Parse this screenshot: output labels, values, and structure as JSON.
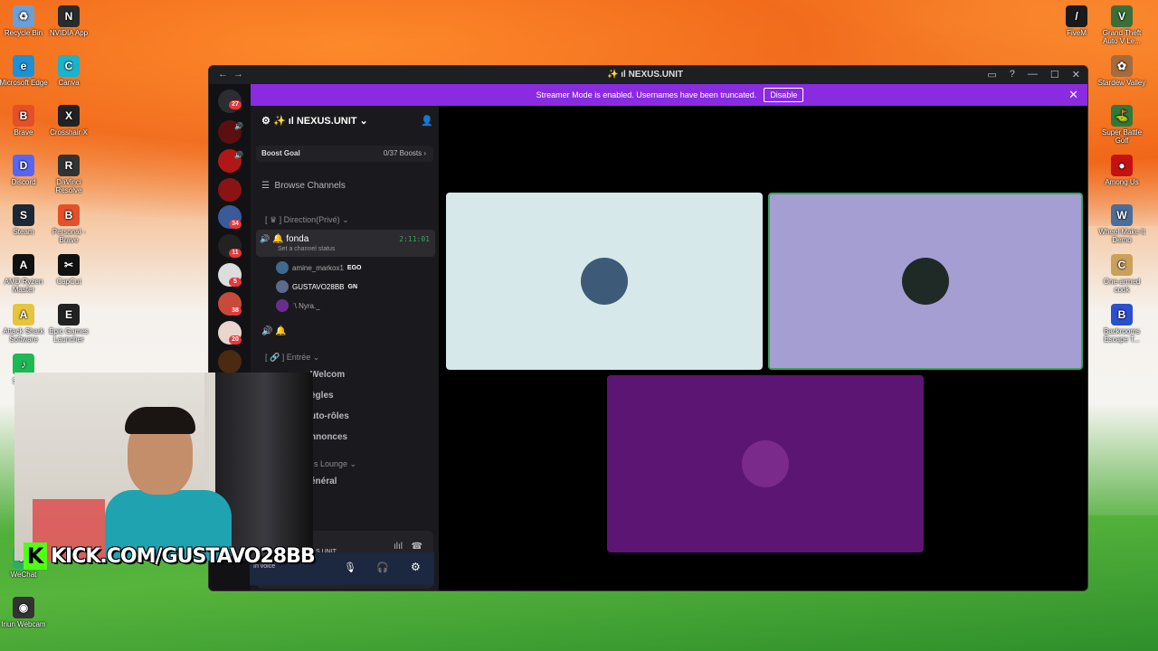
{
  "desktop": {
    "left_icons": [
      {
        "label": "Recycle Bin",
        "color": "#6aa0d8",
        "glyph": "♻"
      },
      {
        "label": "NVIDIA App",
        "color": "#2b2b2b",
        "glyph": "N"
      },
      {
        "label": "Microsoft Edge",
        "color": "#1f8fd6",
        "glyph": "e"
      },
      {
        "label": "Canva",
        "color": "#1ab3c9",
        "glyph": "C"
      },
      {
        "label": "Brave",
        "color": "#e3502a",
        "glyph": "B"
      },
      {
        "label": "Crosshair X",
        "color": "#222",
        "glyph": "X"
      },
      {
        "label": "Discord",
        "color": "#5865f2",
        "glyph": "D"
      },
      {
        "label": "DaVinci Resolve",
        "color": "#333",
        "glyph": "R"
      },
      {
        "label": "Steam",
        "color": "#1b2838",
        "glyph": "S"
      },
      {
        "label": "Personal - Brave",
        "color": "#e3502a",
        "glyph": "B"
      },
      {
        "label": "AMD Ryzen Master",
        "color": "#111",
        "glyph": "A"
      },
      {
        "label": "CapCut",
        "color": "#111",
        "glyph": "✂"
      },
      {
        "label": "Attack Shark Software",
        "color": "#e5c53b",
        "glyph": "A"
      },
      {
        "label": "Epic Games Launcher",
        "color": "#222",
        "glyph": "E"
      },
      {
        "label": "Spotify",
        "color": "#1db954",
        "glyph": "♪"
      }
    ],
    "bottom_left_icons": [
      {
        "label": "WeChat",
        "color": "#2aae67",
        "glyph": "W"
      },
      {
        "label": "Iriun Webcam",
        "color": "#333",
        "glyph": "◉"
      }
    ],
    "right_icons": [
      {
        "label": "FiveM",
        "color": "#1a1a1a",
        "glyph": "/"
      },
      {
        "label": "Grand Theft Auto V Le...",
        "color": "#3c6e3a",
        "glyph": "V"
      },
      {
        "label": "Stardew Valley",
        "color": "#a66b3b",
        "glyph": "✿"
      },
      {
        "label": "Super Battle Golf",
        "color": "#2f7a3a",
        "glyph": "⛳"
      },
      {
        "label": "Among Us",
        "color": "#c51111",
        "glyph": "●"
      },
      {
        "label": "Wheel Make It Demo",
        "color": "#4a6e9b",
        "glyph": "W"
      },
      {
        "label": "One-armed cook",
        "color": "#c9a15a",
        "glyph": "C"
      },
      {
        "label": "Backrooms Escape T...",
        "color": "#2a4fd0",
        "glyph": "B"
      }
    ]
  },
  "window": {
    "title": "✨ ıl NEXUS.UNIT",
    "nav_back": "←",
    "nav_forward": "→",
    "ctrl_inbox": "▭",
    "ctrl_help": "?",
    "ctrl_min": "—",
    "ctrl_max": "☐",
    "ctrl_close": "✕"
  },
  "banner": {
    "text": "Streamer Mode is enabled. Usernames have been truncated.",
    "button": "Disable",
    "close": "✕",
    "color": "#8a2be2"
  },
  "server_rail": {
    "home_badge": "27",
    "badges": [
      "34",
      "11",
      "5",
      "38",
      "20"
    ]
  },
  "sidebar": {
    "server_name": "✨ ıl NEXUS.UNIT",
    "boost_label": "Boost Goal",
    "boost_value": "0/37 Boosts ›",
    "browse": "Browse Channels",
    "category_1": "Direction(Privé)",
    "voice_channel": {
      "name": "fonda",
      "timer": "2:11:01",
      "status": "Set a channel status"
    },
    "members": [
      {
        "name": "amine_markox1",
        "tag": "EGO",
        "color": "#3f6a8f"
      },
      {
        "name": "GUSTAVO28BB",
        "tag": "GN",
        "color": "#5a6b8c"
      },
      {
        "name": "ʾ\\ Nyra._",
        "tag": "",
        "color": "#6b2c8f"
      }
    ],
    "category_2": "Entrée",
    "text_channels": [
      "Welcom",
      "ègles",
      "uto-rôles",
      "nnonces"
    ],
    "category_3": "s Lounge",
    "text_channel_general": "énéral",
    "voice_panel_server": "S.UNIT",
    "user_status": "In voice"
  },
  "stage": {
    "tiles": [
      {
        "name": "tile-amine",
        "color": "#d7e8ea",
        "avatar_color": "#3d5a78"
      },
      {
        "name": "tile-gustavo",
        "color": "#a59ed3",
        "avatar_color": "#1f2a26"
      },
      {
        "name": "tile-nyra",
        "color": "#5c1572",
        "avatar_color": "#7a2a8a"
      }
    ]
  },
  "overlay": {
    "kick_logo": "K",
    "kick_url": "KICK.COM/GUSTAVO28BB"
  }
}
